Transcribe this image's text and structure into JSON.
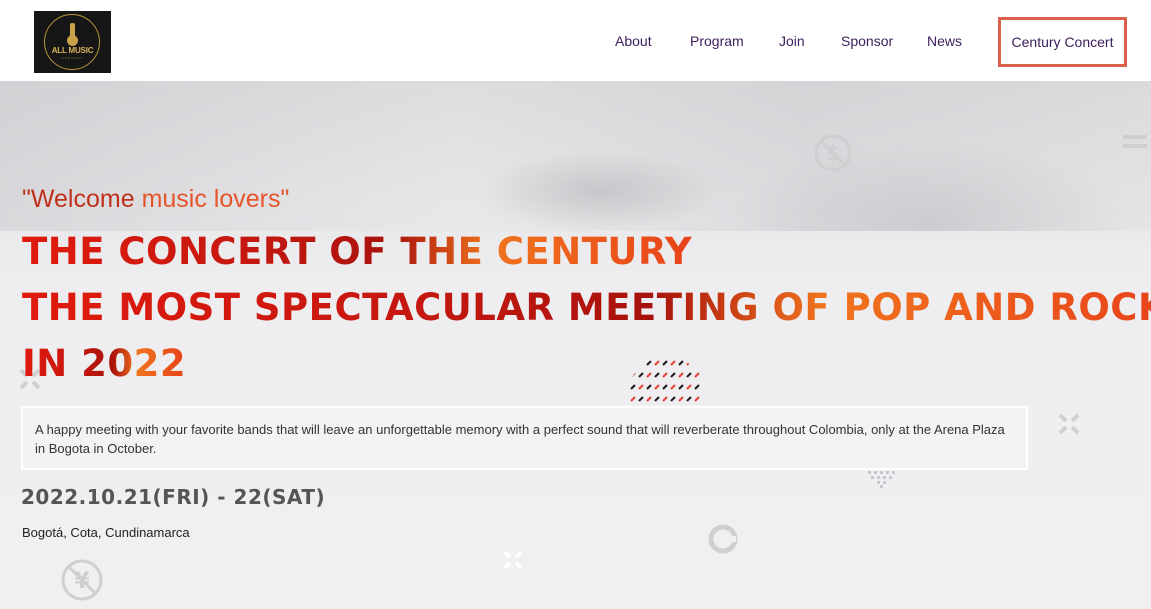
{
  "brand": {
    "logo_text": "ALL MUSIC",
    "logo_subtext": "CONCERT",
    "colors": {
      "logo_bg": "#161616",
      "logo_gold": "#c9a24a"
    }
  },
  "nav": {
    "items": [
      {
        "label": "About"
      },
      {
        "label": "Program"
      },
      {
        "label": "Join"
      },
      {
        "label": "Sponsor"
      },
      {
        "label": "News"
      }
    ],
    "cta_label": "Century Concert",
    "colors": {
      "link": "#3d1d5c",
      "cta_border": "#d9604a"
    }
  },
  "hero": {
    "welcome_prefix": "\"Welcome ",
    "welcome_accent": "music lovers\"",
    "headline_lines": [
      "THE CONCERT OF THE CENTURY",
      "THE MOST SPECTACULAR MEETING OF POP AND ROCK",
      "IN 2022"
    ],
    "description": "A happy meeting with your favorite bands that will leave an unforgettable memory with a perfect sound that will reverberate throughout Colombia, only at the Arena Plaza in Bogota in October.",
    "date": "2022.10.21(FRI) - 22(SAT)",
    "location": "Bogotá, Cota, Cundinamarca",
    "colors": {
      "headline_red": "#c41810",
      "headline_orange": "#f0741e",
      "welcome": "#c0311c"
    },
    "decorative_icons": [
      "dollar-icon",
      "yen-icon",
      "copyright-icon",
      "cross-icon",
      "dots-pattern"
    ]
  }
}
